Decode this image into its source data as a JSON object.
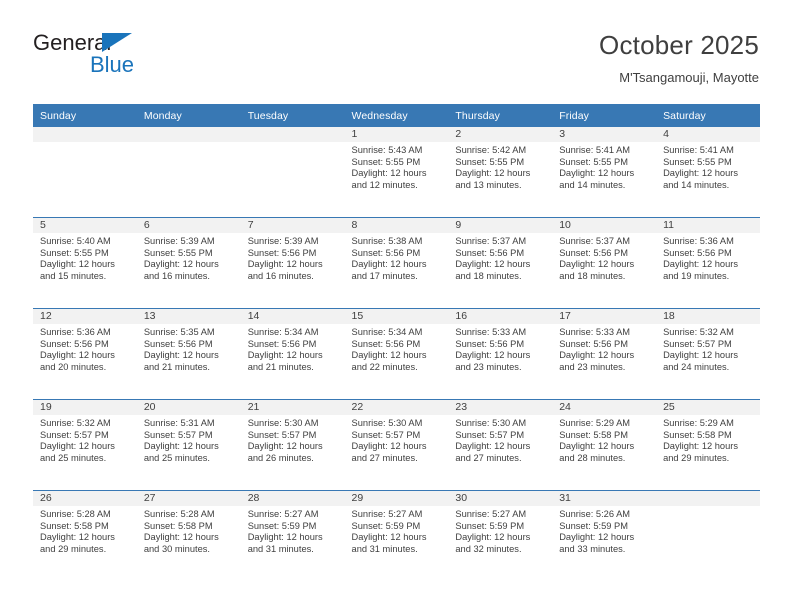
{
  "brand": {
    "line1": "General",
    "line2": "Blue",
    "triangle_color": "#1a74bb",
    "text_color": "#231f20"
  },
  "header": {
    "title": "October 2025",
    "subtitle": "M'Tsangamouji, Mayotte"
  },
  "colors": {
    "header_blue": "#3878b4",
    "daynum_band": "#f2f2f2",
    "text": "#3f3f3f"
  },
  "calendar": {
    "weekday_headers": [
      "Sunday",
      "Monday",
      "Tuesday",
      "Wednesday",
      "Thursday",
      "Friday",
      "Saturday"
    ],
    "labels": {
      "sunrise": "Sunrise:",
      "sunset": "Sunset:",
      "daylight": "Daylight:"
    },
    "weeks": [
      [
        {
          "day": "",
          "blank": true
        },
        {
          "day": "",
          "blank": true
        },
        {
          "day": "",
          "blank": true
        },
        {
          "day": "1",
          "sunrise": "Sunrise: 5:43 AM",
          "sunset": "Sunset: 5:55 PM",
          "daylight1": "Daylight: 12 hours",
          "daylight2": "and 12 minutes."
        },
        {
          "day": "2",
          "sunrise": "Sunrise: 5:42 AM",
          "sunset": "Sunset: 5:55 PM",
          "daylight1": "Daylight: 12 hours",
          "daylight2": "and 13 minutes."
        },
        {
          "day": "3",
          "sunrise": "Sunrise: 5:41 AM",
          "sunset": "Sunset: 5:55 PM",
          "daylight1": "Daylight: 12 hours",
          "daylight2": "and 14 minutes."
        },
        {
          "day": "4",
          "sunrise": "Sunrise: 5:41 AM",
          "sunset": "Sunset: 5:55 PM",
          "daylight1": "Daylight: 12 hours",
          "daylight2": "and 14 minutes."
        }
      ],
      [
        {
          "day": "5",
          "sunrise": "Sunrise: 5:40 AM",
          "sunset": "Sunset: 5:55 PM",
          "daylight1": "Daylight: 12 hours",
          "daylight2": "and 15 minutes."
        },
        {
          "day": "6",
          "sunrise": "Sunrise: 5:39 AM",
          "sunset": "Sunset: 5:55 PM",
          "daylight1": "Daylight: 12 hours",
          "daylight2": "and 16 minutes."
        },
        {
          "day": "7",
          "sunrise": "Sunrise: 5:39 AM",
          "sunset": "Sunset: 5:56 PM",
          "daylight1": "Daylight: 12 hours",
          "daylight2": "and 16 minutes."
        },
        {
          "day": "8",
          "sunrise": "Sunrise: 5:38 AM",
          "sunset": "Sunset: 5:56 PM",
          "daylight1": "Daylight: 12 hours",
          "daylight2": "and 17 minutes."
        },
        {
          "day": "9",
          "sunrise": "Sunrise: 5:37 AM",
          "sunset": "Sunset: 5:56 PM",
          "daylight1": "Daylight: 12 hours",
          "daylight2": "and 18 minutes."
        },
        {
          "day": "10",
          "sunrise": "Sunrise: 5:37 AM",
          "sunset": "Sunset: 5:56 PM",
          "daylight1": "Daylight: 12 hours",
          "daylight2": "and 18 minutes."
        },
        {
          "day": "11",
          "sunrise": "Sunrise: 5:36 AM",
          "sunset": "Sunset: 5:56 PM",
          "daylight1": "Daylight: 12 hours",
          "daylight2": "and 19 minutes."
        }
      ],
      [
        {
          "day": "12",
          "sunrise": "Sunrise: 5:36 AM",
          "sunset": "Sunset: 5:56 PM",
          "daylight1": "Daylight: 12 hours",
          "daylight2": "and 20 minutes."
        },
        {
          "day": "13",
          "sunrise": "Sunrise: 5:35 AM",
          "sunset": "Sunset: 5:56 PM",
          "daylight1": "Daylight: 12 hours",
          "daylight2": "and 21 minutes."
        },
        {
          "day": "14",
          "sunrise": "Sunrise: 5:34 AM",
          "sunset": "Sunset: 5:56 PM",
          "daylight1": "Daylight: 12 hours",
          "daylight2": "and 21 minutes."
        },
        {
          "day": "15",
          "sunrise": "Sunrise: 5:34 AM",
          "sunset": "Sunset: 5:56 PM",
          "daylight1": "Daylight: 12 hours",
          "daylight2": "and 22 minutes."
        },
        {
          "day": "16",
          "sunrise": "Sunrise: 5:33 AM",
          "sunset": "Sunset: 5:56 PM",
          "daylight1": "Daylight: 12 hours",
          "daylight2": "and 23 minutes."
        },
        {
          "day": "17",
          "sunrise": "Sunrise: 5:33 AM",
          "sunset": "Sunset: 5:56 PM",
          "daylight1": "Daylight: 12 hours",
          "daylight2": "and 23 minutes."
        },
        {
          "day": "18",
          "sunrise": "Sunrise: 5:32 AM",
          "sunset": "Sunset: 5:57 PM",
          "daylight1": "Daylight: 12 hours",
          "daylight2": "and 24 minutes."
        }
      ],
      [
        {
          "day": "19",
          "sunrise": "Sunrise: 5:32 AM",
          "sunset": "Sunset: 5:57 PM",
          "daylight1": "Daylight: 12 hours",
          "daylight2": "and 25 minutes."
        },
        {
          "day": "20",
          "sunrise": "Sunrise: 5:31 AM",
          "sunset": "Sunset: 5:57 PM",
          "daylight1": "Daylight: 12 hours",
          "daylight2": "and 25 minutes."
        },
        {
          "day": "21",
          "sunrise": "Sunrise: 5:30 AM",
          "sunset": "Sunset: 5:57 PM",
          "daylight1": "Daylight: 12 hours",
          "daylight2": "and 26 minutes."
        },
        {
          "day": "22",
          "sunrise": "Sunrise: 5:30 AM",
          "sunset": "Sunset: 5:57 PM",
          "daylight1": "Daylight: 12 hours",
          "daylight2": "and 27 minutes."
        },
        {
          "day": "23",
          "sunrise": "Sunrise: 5:30 AM",
          "sunset": "Sunset: 5:57 PM",
          "daylight1": "Daylight: 12 hours",
          "daylight2": "and 27 minutes."
        },
        {
          "day": "24",
          "sunrise": "Sunrise: 5:29 AM",
          "sunset": "Sunset: 5:58 PM",
          "daylight1": "Daylight: 12 hours",
          "daylight2": "and 28 minutes."
        },
        {
          "day": "25",
          "sunrise": "Sunrise: 5:29 AM",
          "sunset": "Sunset: 5:58 PM",
          "daylight1": "Daylight: 12 hours",
          "daylight2": "and 29 minutes."
        }
      ],
      [
        {
          "day": "26",
          "sunrise": "Sunrise: 5:28 AM",
          "sunset": "Sunset: 5:58 PM",
          "daylight1": "Daylight: 12 hours",
          "daylight2": "and 29 minutes."
        },
        {
          "day": "27",
          "sunrise": "Sunrise: 5:28 AM",
          "sunset": "Sunset: 5:58 PM",
          "daylight1": "Daylight: 12 hours",
          "daylight2": "and 30 minutes."
        },
        {
          "day": "28",
          "sunrise": "Sunrise: 5:27 AM",
          "sunset": "Sunset: 5:59 PM",
          "daylight1": "Daylight: 12 hours",
          "daylight2": "and 31 minutes."
        },
        {
          "day": "29",
          "sunrise": "Sunrise: 5:27 AM",
          "sunset": "Sunset: 5:59 PM",
          "daylight1": "Daylight: 12 hours",
          "daylight2": "and 31 minutes."
        },
        {
          "day": "30",
          "sunrise": "Sunrise: 5:27 AM",
          "sunset": "Sunset: 5:59 PM",
          "daylight1": "Daylight: 12 hours",
          "daylight2": "and 32 minutes."
        },
        {
          "day": "31",
          "sunrise": "Sunrise: 5:26 AM",
          "sunset": "Sunset: 5:59 PM",
          "daylight1": "Daylight: 12 hours",
          "daylight2": "and 33 minutes."
        },
        {
          "day": "",
          "blank": true
        }
      ]
    ]
  }
}
